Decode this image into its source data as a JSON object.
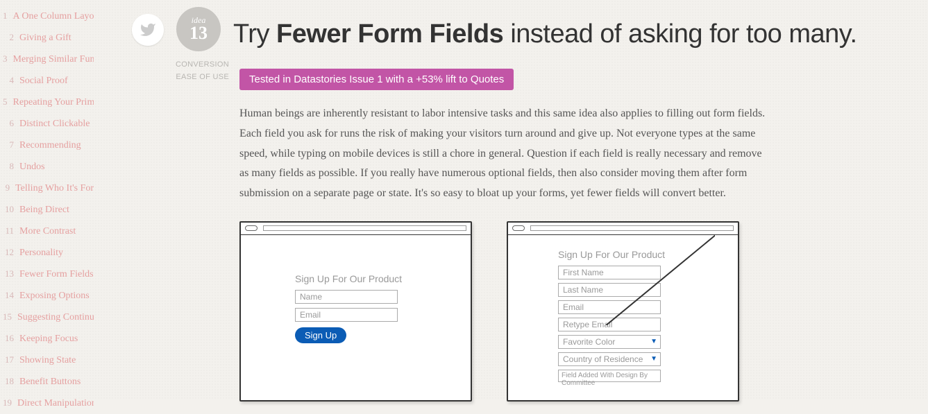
{
  "sidebar": {
    "items": [
      {
        "n": "1",
        "label": "A One Column Layout"
      },
      {
        "n": "2",
        "label": "Giving a Gift"
      },
      {
        "n": "3",
        "label": "Merging Similar Functions"
      },
      {
        "n": "4",
        "label": "Social Proof"
      },
      {
        "n": "5",
        "label": "Repeating Your Primary"
      },
      {
        "n": "6",
        "label": "Distinct Clickable"
      },
      {
        "n": "7",
        "label": "Recommending"
      },
      {
        "n": "8",
        "label": "Undos"
      },
      {
        "n": "9",
        "label": "Telling Who It's For"
      },
      {
        "n": "10",
        "label": "Being Direct"
      },
      {
        "n": "11",
        "label": "More Contrast"
      },
      {
        "n": "12",
        "label": "Personality"
      },
      {
        "n": "13",
        "label": "Fewer Form Fields"
      },
      {
        "n": "14",
        "label": "Exposing Options"
      },
      {
        "n": "15",
        "label": "Suggesting Continuity"
      },
      {
        "n": "16",
        "label": "Keeping Focus"
      },
      {
        "n": "17",
        "label": "Showing State"
      },
      {
        "n": "18",
        "label": "Benefit Buttons"
      },
      {
        "n": "19",
        "label": "Direct Manipulation"
      }
    ]
  },
  "idea": {
    "label": "idea",
    "number": "13"
  },
  "title": {
    "pre": "Try ",
    "bold": "Fewer Form Fields",
    "post": " instead of asking for too many."
  },
  "tags": [
    "CONVERSION",
    "EASE OF USE"
  ],
  "badge_text": "Tested in Datastories Issue 1 with a +53% lift to Quotes",
  "body": "Human beings are inherently resistant to labor intensive tasks and this same idea also applies to filling out form fields. Each field you ask for runs the risk of making your visitors turn around and give up. Not everyone types at the same speed, while typing on mobile devices is still a chore in general. Question if each field is really necessary and remove as many fields as possible. If you really have numerous optional fields, then also consider moving them after form submission on a separate page or state. It's so easy to bloat up your forms, yet fewer fields will convert better.",
  "mockup_good": {
    "title": "Sign Up For Our Product",
    "fields": [
      "Name",
      "Email"
    ],
    "button": "Sign Up"
  },
  "mockup_bad": {
    "title": "Sign Up For Our Product",
    "fields": [
      "First Name",
      "Last Name",
      "Email",
      "Retype Email"
    ],
    "selects": [
      "Favorite Color",
      "Country of Residence"
    ],
    "extra": "Field Added With Design By Committee"
  }
}
